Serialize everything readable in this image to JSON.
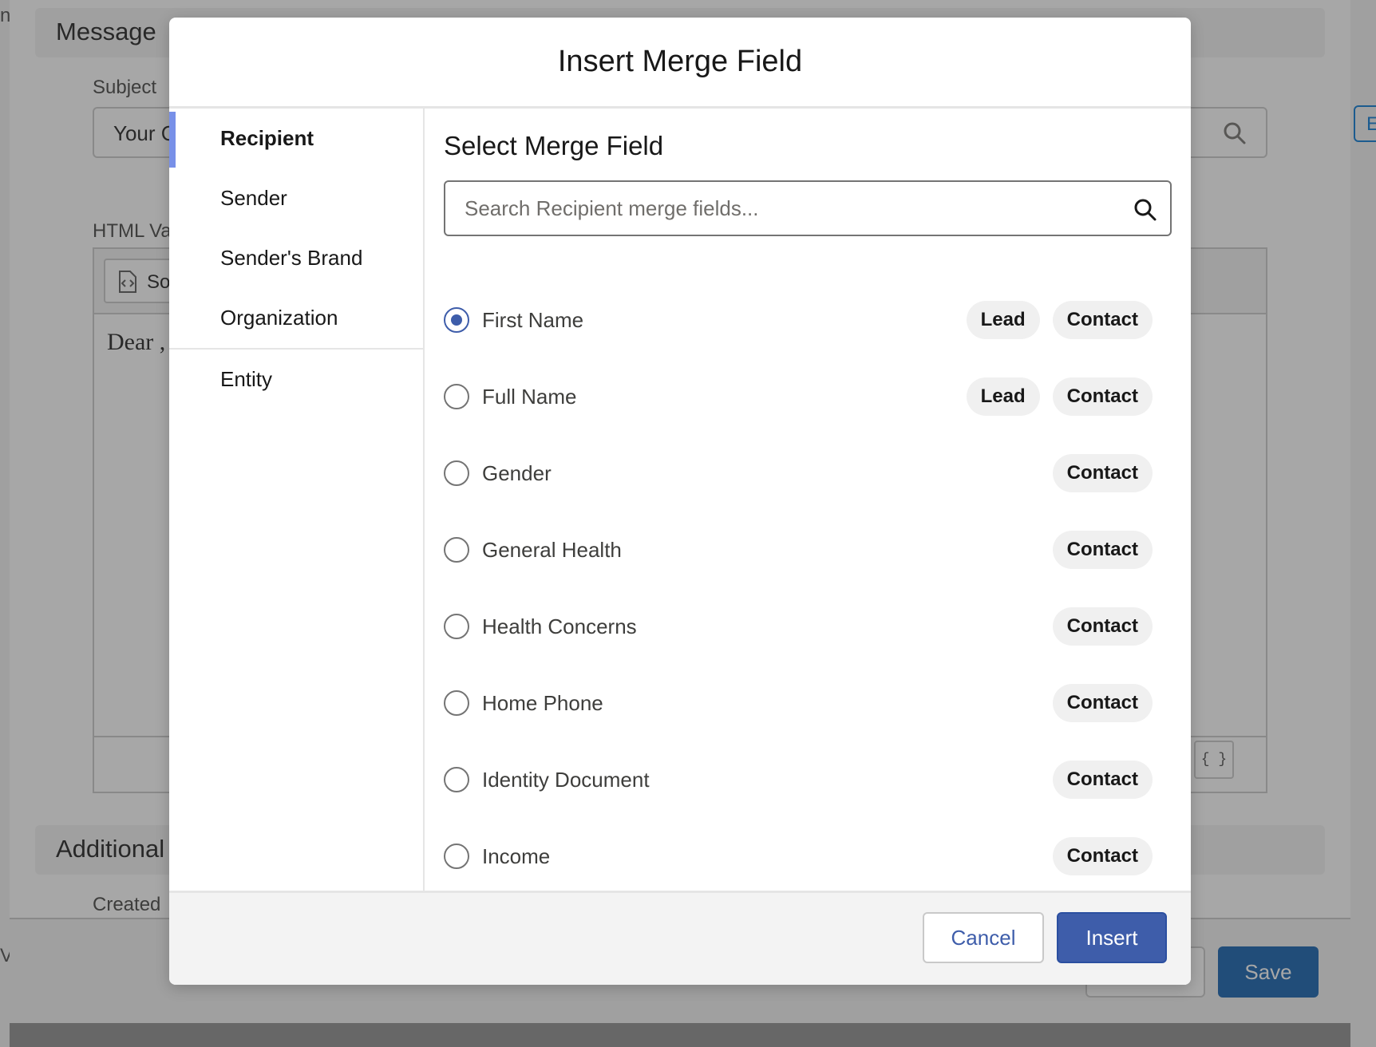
{
  "background": {
    "section_message_title": "Message",
    "subject_label": "Subject",
    "subject_value": "Your C",
    "html_value_label": "HTML Va",
    "source_button_label": "So",
    "editor_body_text": "Dear ,",
    "braces_button": "{ }",
    "section_additional_title": "Additional",
    "created_label": "Created",
    "save_button": "Save",
    "right_edge_text": "E",
    "left_edge_top": "n",
    "left_edge_bottom": "V"
  },
  "modal": {
    "title": "Insert Merge Field",
    "sidebar": {
      "items": [
        {
          "label": "Recipient",
          "active": true
        },
        {
          "label": "Sender",
          "active": false
        },
        {
          "label": "Sender's Brand",
          "active": false
        },
        {
          "label": "Organization",
          "active": false
        },
        {
          "label": "Entity",
          "active": false
        }
      ]
    },
    "main": {
      "title": "Select Merge Field",
      "search_placeholder": "Search Recipient merge fields...",
      "fields": [
        {
          "label": "First Name",
          "selected": true,
          "badges": [
            "Lead",
            "Contact"
          ]
        },
        {
          "label": "Full Name",
          "selected": false,
          "badges": [
            "Lead",
            "Contact"
          ]
        },
        {
          "label": "Gender",
          "selected": false,
          "badges": [
            "Contact"
          ]
        },
        {
          "label": "General Health",
          "selected": false,
          "badges": [
            "Contact"
          ]
        },
        {
          "label": "Health Concerns",
          "selected": false,
          "badges": [
            "Contact"
          ]
        },
        {
          "label": "Home Phone",
          "selected": false,
          "badges": [
            "Contact"
          ]
        },
        {
          "label": "Identity Document",
          "selected": false,
          "badges": [
            "Contact"
          ]
        },
        {
          "label": "Income",
          "selected": false,
          "badges": [
            "Contact"
          ]
        }
      ]
    },
    "footer": {
      "cancel_label": "Cancel",
      "insert_label": "Insert"
    }
  },
  "colors": {
    "accent": "#3e5daa",
    "sidebar_active_bar": "#7890e8",
    "badge_bg": "#f0f0f0"
  }
}
